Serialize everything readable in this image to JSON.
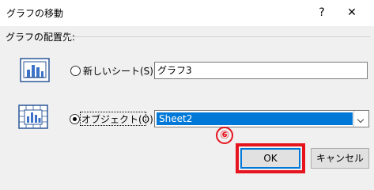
{
  "dialog": {
    "title": "グラフの移動",
    "help": "?",
    "close": "✕"
  },
  "placement": {
    "group_label": "グラフの配置先:",
    "new_sheet": {
      "label": "新しいシート(S):",
      "value": "グラフ3",
      "selected": false
    },
    "object": {
      "label": "オブジェクト(O):",
      "value": "Sheet2",
      "selected": true
    }
  },
  "annotation": {
    "step": "⑥",
    "color": "#e6141e"
  },
  "buttons": {
    "ok": "OK",
    "cancel": "キャンセル"
  },
  "accent_color": "#0078d7"
}
